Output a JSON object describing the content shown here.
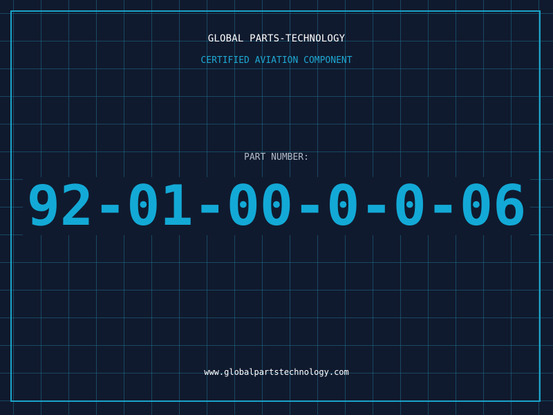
{
  "header": {
    "company": "GLOBAL PARTS-TECHNOLOGY",
    "subtitle": "CERTIFIED AVIATION COMPONENT"
  },
  "part": {
    "label": "PART NUMBER:",
    "number": "92-01-00-0-0-06"
  },
  "footer": {
    "website": "www.globalpartstechnology.com"
  },
  "colors": {
    "background": "#101a2e",
    "grid": "#1d6e8c",
    "accent": "#13a9d6",
    "frame": "#1aa3c8"
  }
}
